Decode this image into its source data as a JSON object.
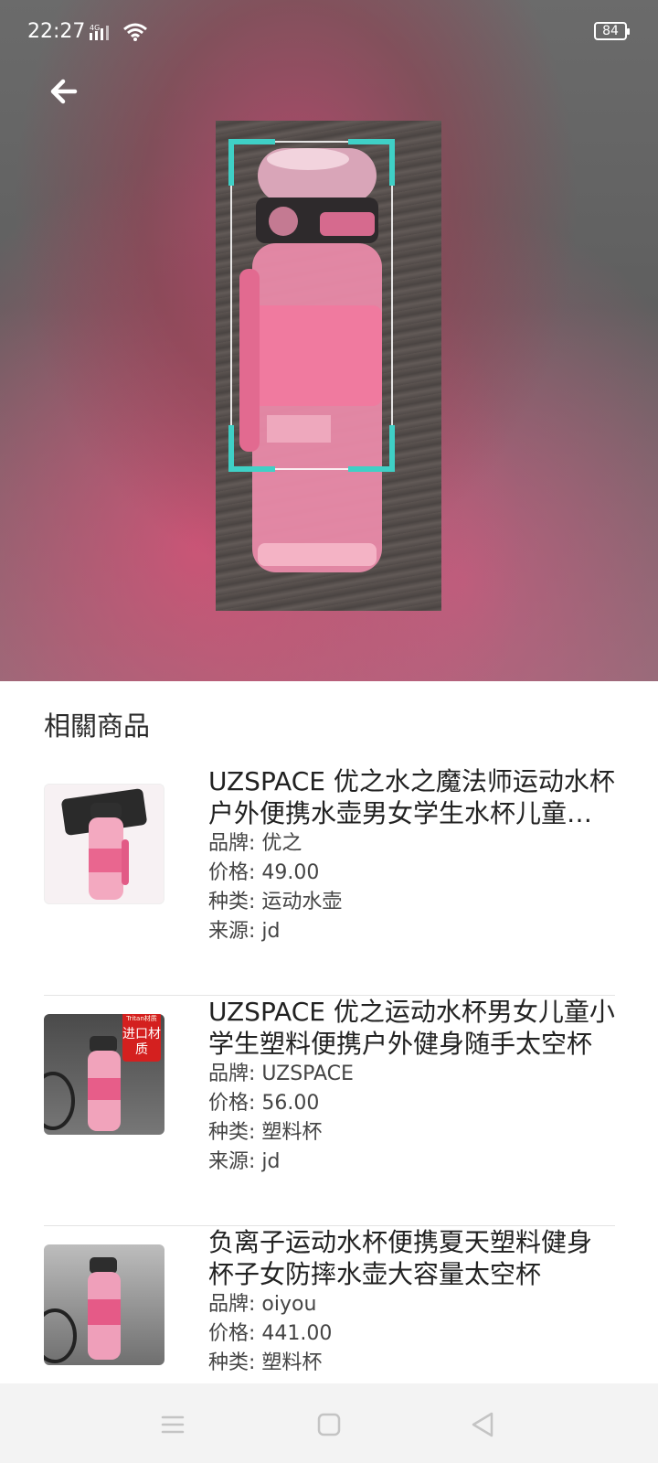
{
  "status_bar": {
    "time": "22:27",
    "network": "4G",
    "battery": "84"
  },
  "header": {
    "back_icon": "arrow-left-icon"
  },
  "related": {
    "title": "相關商品",
    "items": [
      {
        "title": "UZSPACE 优之水之魔法师运动水杯户外便携水壶男女学生水杯儿童塑料杯子大容量太空杯",
        "brand_label": "品牌: ",
        "brand": "优之",
        "price_label": "价格: ",
        "price": "49.00",
        "category_label": "种类: ",
        "category": "运动水壶",
        "source_label": "来源: ",
        "source": "jd"
      },
      {
        "title": "UZSPACE 优之运动水杯男女儿童小学生塑料便携户外健身随手太空杯",
        "brand_label": "品牌: ",
        "brand": "UZSPACE",
        "price_label": "价格: ",
        "price": "56.00",
        "category_label": "种类: ",
        "category": "塑料杯",
        "source_label": "来源: ",
        "source": "jd",
        "badge_top": "Tritan材质",
        "badge_text": "进口材质"
      },
      {
        "title": "负离子运动水杯便携夏天塑料健身杯子女防摔水壶大容量太空杯",
        "brand_label": "品牌: ",
        "brand": "oiyou",
        "price_label": "价格: ",
        "price": "441.00",
        "category_label": "种类: ",
        "category": "塑料杯"
      }
    ]
  },
  "nav_bar": {
    "menu_icon": "menu-icon",
    "home_icon": "home-square-icon",
    "back_icon": "back-triangle-icon"
  }
}
